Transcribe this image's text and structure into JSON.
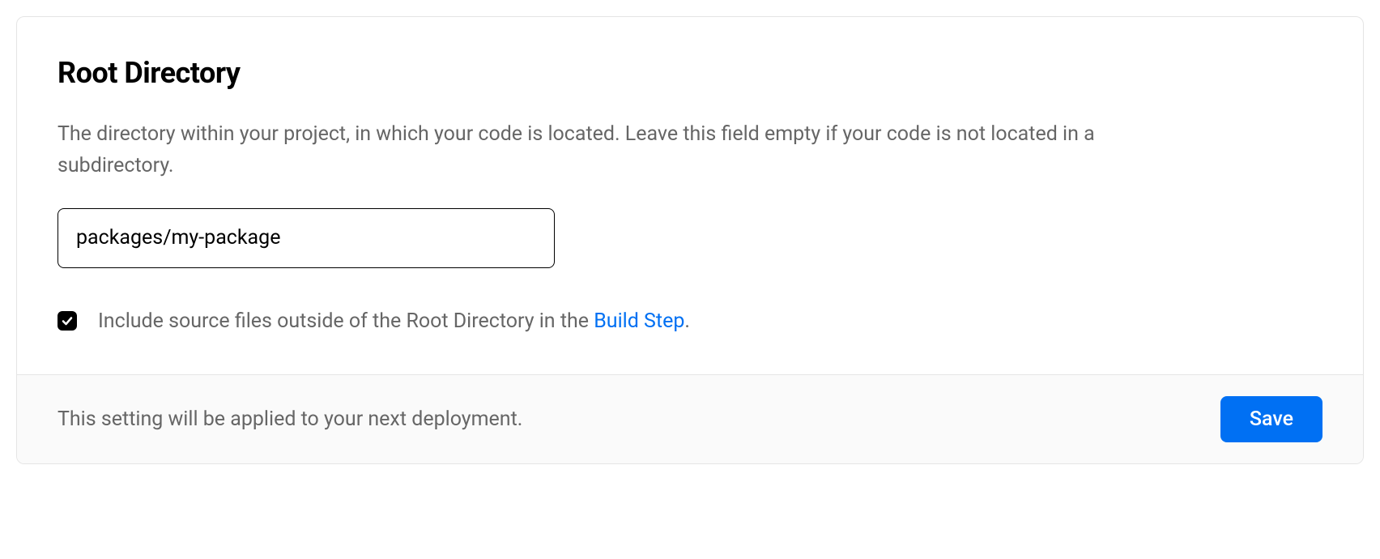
{
  "card": {
    "title": "Root Directory",
    "description": "The directory within your project, in which your code is located. Leave this field empty if your code is not located in a subdirectory.",
    "input": {
      "value": "packages/my-package",
      "placeholder": ""
    },
    "checkbox": {
      "checked": true,
      "label_before": "Include source files outside of the Root Directory in the ",
      "link_text": "Build Step",
      "label_after": "."
    },
    "footer": {
      "note": "This setting will be applied to your next deployment.",
      "save_label": "Save"
    }
  }
}
